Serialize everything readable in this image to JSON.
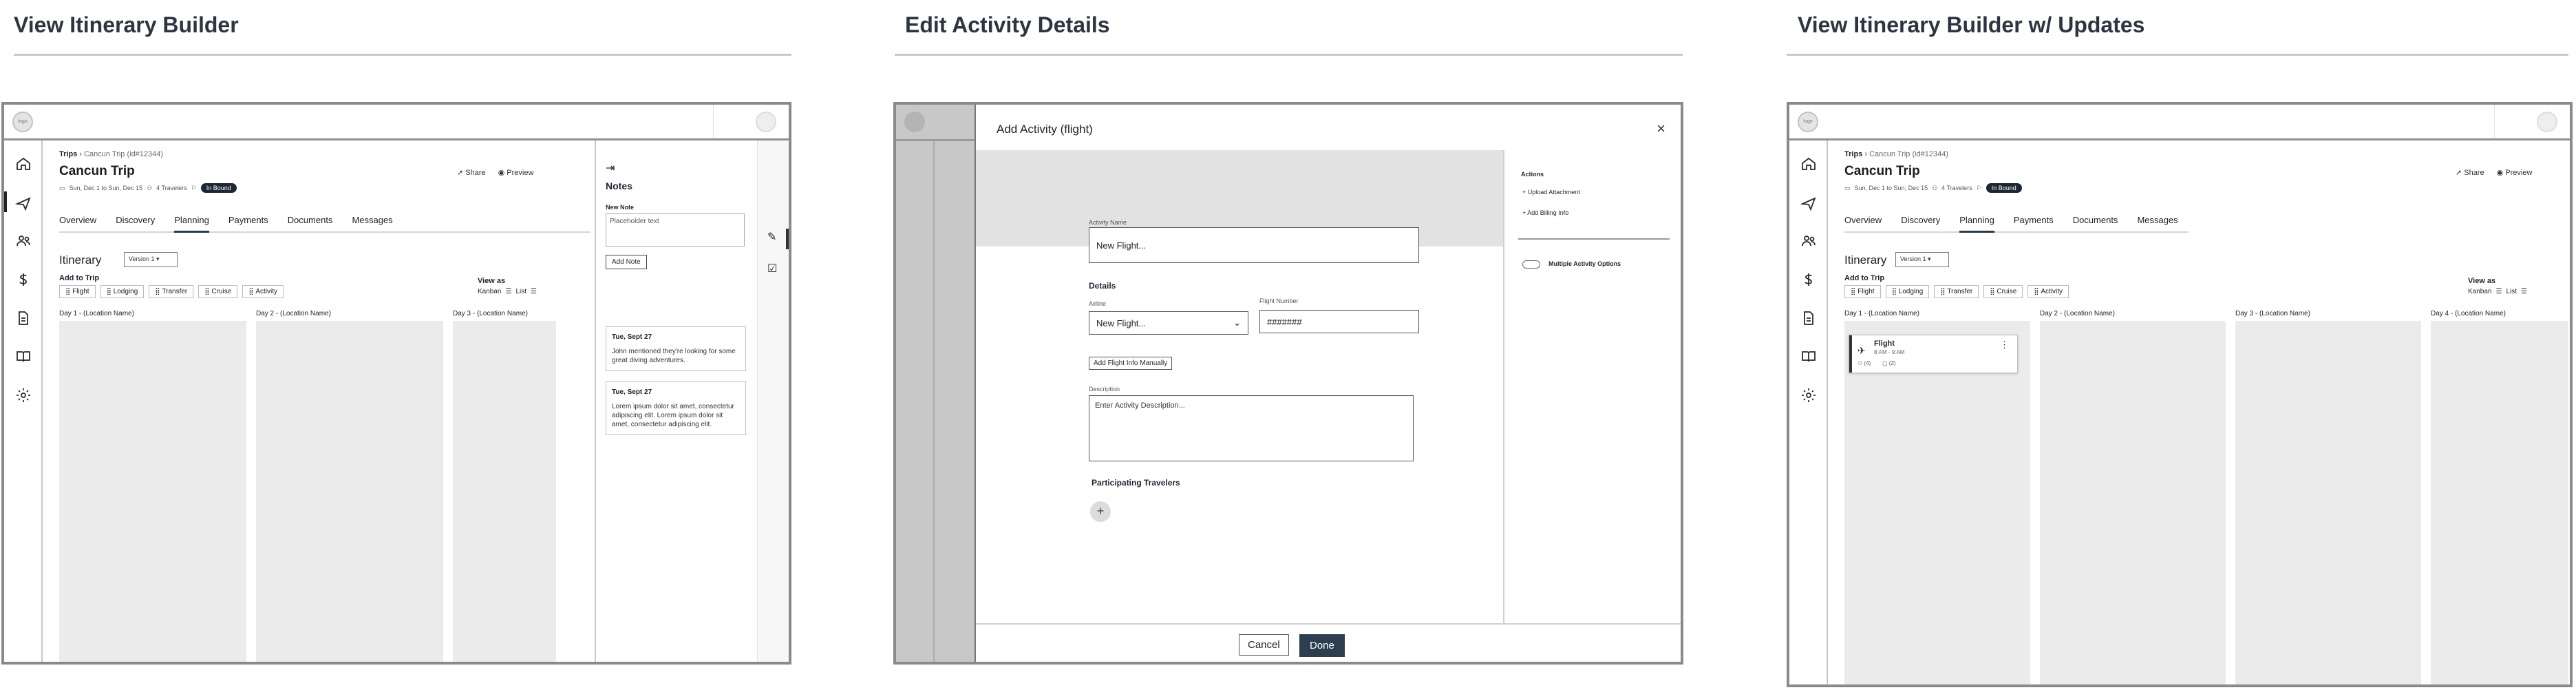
{
  "sections": [
    {
      "title": "View Itinerary Builder"
    },
    {
      "title": "Edit Activity Details"
    },
    {
      "title": "View Itinerary Builder w/ Updates"
    }
  ],
  "app": {
    "logo_label": "logo",
    "breadcrumb_root": "Trips",
    "breadcrumb_current": "Cancun Trip (id#12344)",
    "trip_title": "Cancun Trip",
    "dates": "Sun, Dec 1 to Sun, Dec 15",
    "travelers": "4 Travelers",
    "status": "In Bound",
    "share": "Share",
    "preview": "Preview",
    "tabs": [
      "Overview",
      "Discovery",
      "Planning",
      "Payments",
      "Documents",
      "Messages"
    ],
    "itinerary_label": "Itinerary",
    "version": "Version 1",
    "add_to_trip": "Add to Trip",
    "add_chips": [
      "Flight",
      "Lodging",
      "Transfer",
      "Cruise",
      "Activity"
    ],
    "view_as": "View as",
    "view_kanban": "Kanban",
    "view_list": "List",
    "nav_icons": [
      "home-icon",
      "plane-icon",
      "users-icon",
      "dollar-icon",
      "document-icon",
      "book-icon",
      "gear-icon"
    ]
  },
  "builder": {
    "days": [
      "Day 1 - (Location Name)",
      "Day 2 - (Location Name)",
      "Day 3 - (Location Name)"
    ]
  },
  "notes": {
    "title": "Notes",
    "new_note_label": "New Note",
    "placeholder": "Placeholder text",
    "add_note": "Add Note",
    "cards": [
      {
        "date": "Tue, Sept 27",
        "text": "John mentioned they're looking for some great diving adventures."
      },
      {
        "date": "Tue, Sept 27",
        "text": "Lorem ipsum dolor sit amet, consectetur adipiscing elit. Lorem ipsum dolor sit amet, consectetur adipiscing elit."
      }
    ]
  },
  "modal": {
    "title": "Add Activity (flight)",
    "activity_name_label": "Activity Name",
    "activity_name_value": "New Flight...",
    "details_heading": "Details",
    "airline_label": "Airline",
    "airline_value": "New Flight...",
    "flight_number_label": "Flight Number",
    "flight_number_value": "#######",
    "add_flight_info": "Add Flight Info Manually",
    "description_label": "Description",
    "description_placeholder": "Enter Activity Description...",
    "participants_heading": "Participating Travelers",
    "actions_heading": "Actions",
    "action_upload": "Upload Attachment",
    "action_billing": "Add Billing Info",
    "multiple_options": "Multiple Activity Options",
    "cancel": "Cancel",
    "done": "Done"
  },
  "updated": {
    "days": [
      "Day 1 - (Location Name)",
      "Day 2 - (Location Name)",
      "Day 3 - (Location Name)",
      "Day 4 - (Location Name)"
    ],
    "card_title": "Flight",
    "card_subtitle": "8:AM - 9:AM",
    "card_count_a": "(4)",
    "card_count_b": "(2)"
  }
}
